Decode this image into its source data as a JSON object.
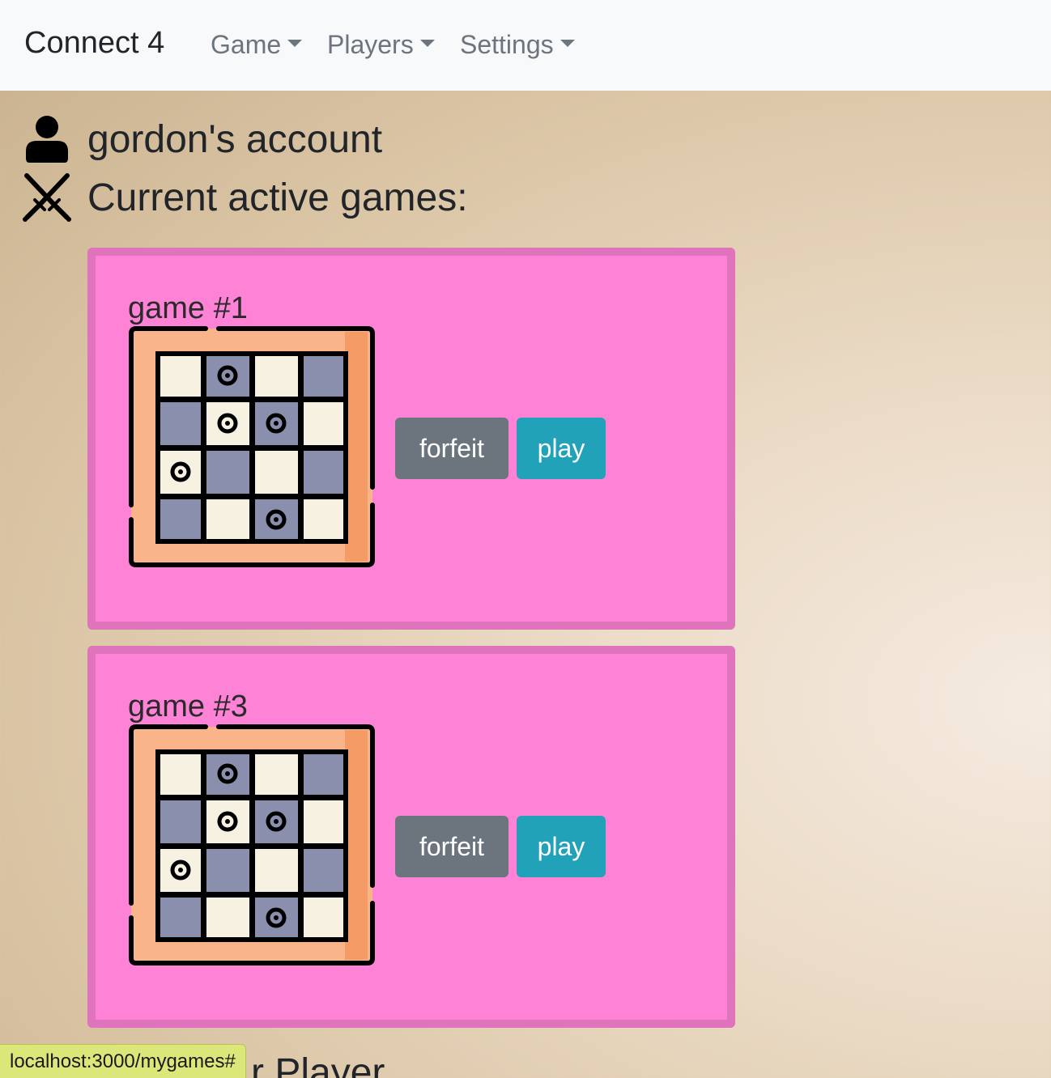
{
  "navbar": {
    "brand": "Connect 4",
    "items": [
      {
        "label": "Game"
      },
      {
        "label": "Players"
      },
      {
        "label": "Settings"
      }
    ]
  },
  "account": {
    "title": "gordon's account",
    "icon": "user-icon"
  },
  "active_games": {
    "heading": "Current active games:",
    "icon": "crossed-swords-icon",
    "games": [
      {
        "title": "game #1",
        "forfeit_label": "forfeit",
        "play_label": "play"
      },
      {
        "title": "game #3",
        "forfeit_label": "forfeit",
        "play_label": "play"
      }
    ]
  },
  "partial_heading": "r Player",
  "status_bar": {
    "url": "localhost:3000/mygames#"
  },
  "colors": {
    "card_bg": "#fe82d6",
    "card_border": "#df73bc",
    "forfeit_button": "#6c757d",
    "play_button": "#22a2b8",
    "navbar_bg": "#f8f9fa"
  }
}
